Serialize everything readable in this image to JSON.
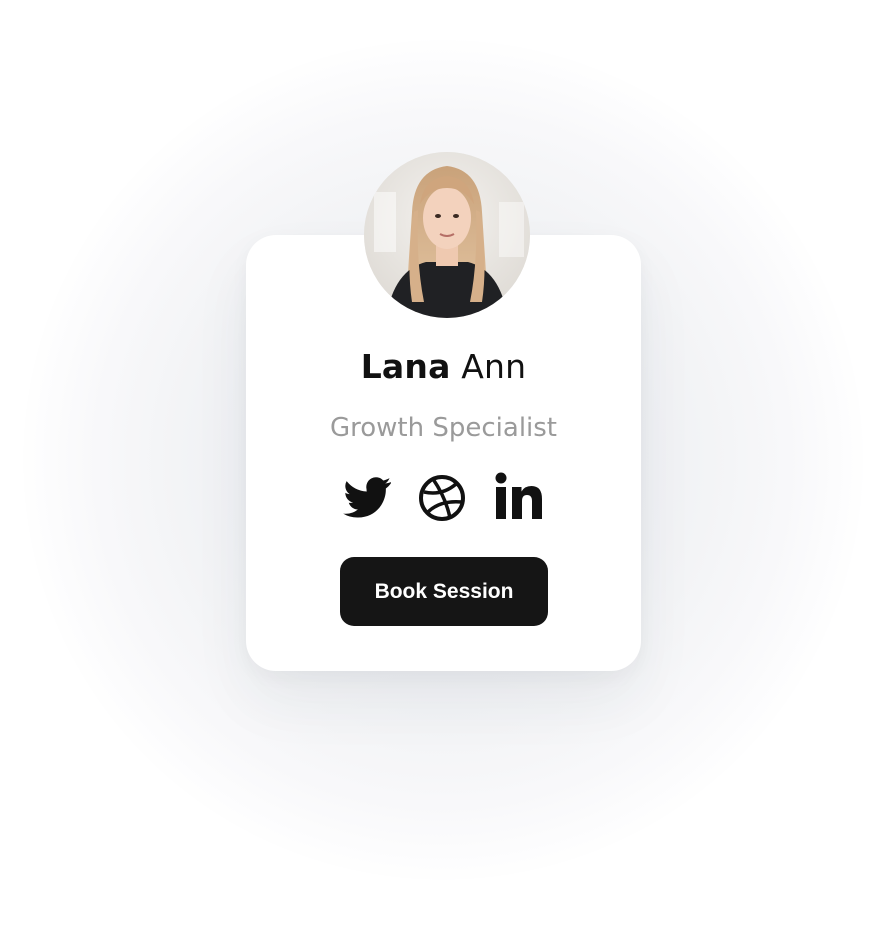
{
  "profile": {
    "first_name": "Lana",
    "last_name": "Ann",
    "role": "Growth Specialist",
    "avatar": "profile-photo"
  },
  "socials": [
    {
      "icon": "twitter-icon"
    },
    {
      "icon": "dribbble-icon"
    },
    {
      "icon": "linkedin-icon"
    }
  ],
  "cta": {
    "label": "Book Session"
  },
  "colors": {
    "background": "#ffffff",
    "card": "#ffffff",
    "text_primary": "#111111",
    "text_secondary": "#9a9a9a",
    "button_bg": "#151515",
    "button_text": "#ffffff"
  }
}
